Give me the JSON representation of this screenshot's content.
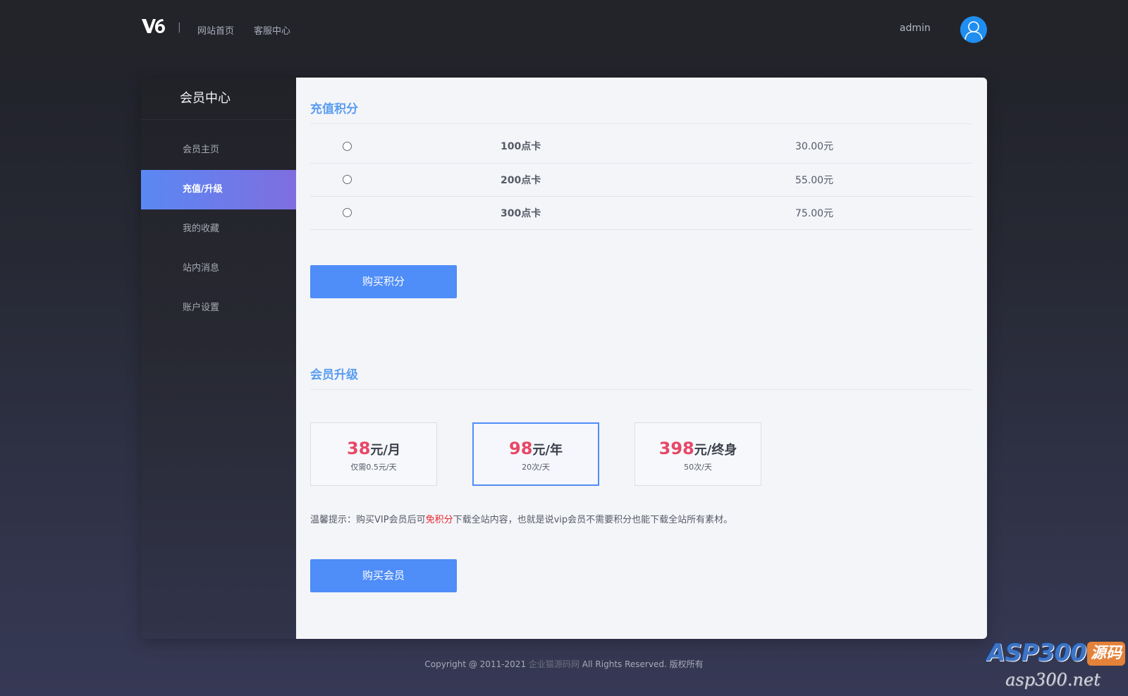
{
  "header": {
    "separator": "|",
    "nav": [
      {
        "label": "网站首页"
      },
      {
        "label": "客服中心"
      }
    ],
    "user": "admin"
  },
  "sidebar": {
    "title": "会员中心",
    "items": [
      {
        "label": "会员主页"
      },
      {
        "label": "充值/升级"
      },
      {
        "label": "我的收藏"
      },
      {
        "label": "站内消息"
      },
      {
        "label": "账户设置"
      }
    ]
  },
  "points": {
    "title": "充值积分",
    "rows": [
      {
        "name": "100点卡",
        "price": "30.00元"
      },
      {
        "name": "200点卡",
        "price": "55.00元"
      },
      {
        "name": "300点卡",
        "price": "75.00元"
      }
    ],
    "buy_label": "购买积分"
  },
  "vip": {
    "title": "会员升级",
    "plans": [
      {
        "amount": "38",
        "unit": "元/月",
        "desc": "仅需0.5元/天"
      },
      {
        "amount": "98",
        "unit": "元/年",
        "desc": "20次/天"
      },
      {
        "amount": "398",
        "unit": "元/终身",
        "desc": "50次/天"
      }
    ],
    "tip_before": "温馨提示：购买VIP会员后可",
    "tip_highlight": "免积分",
    "tip_after": "下载全站内容，也就是说vip会员不需要积分也能下载全站所有素材。",
    "buy_label": "购买会员"
  },
  "footer": {
    "before": "Copyright @ 2011-2021 ",
    "site": "企业猫源码网",
    "after": " All Rights Reserved. 版权所有"
  },
  "watermark": {
    "top": "ASP300",
    "badge": "源码",
    "bottom": "asp300.net"
  },
  "colors": {
    "accent": "#4f8df8",
    "section_title": "#5a9df0",
    "price_red": "#e74867",
    "highlight_red": "#e8232b"
  }
}
